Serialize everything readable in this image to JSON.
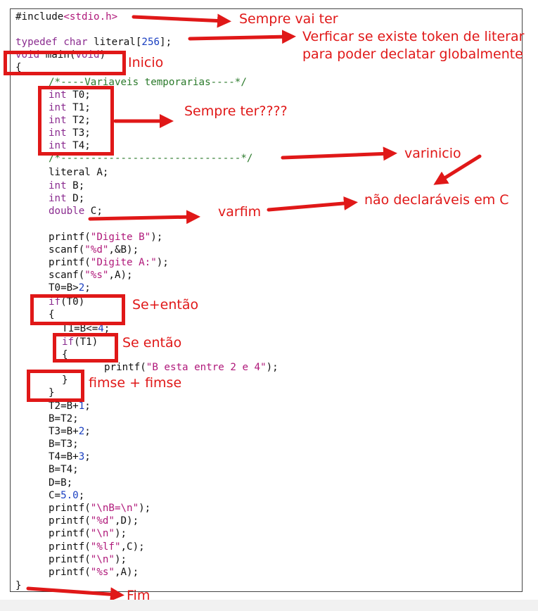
{
  "code": {
    "include_head": "#include",
    "include_header": "<stdio.h>",
    "typedef_kw": "typedef",
    "typedef_type": "char",
    "typedef_name": "literal",
    "typedef_open": "[",
    "typedef_size": "256",
    "typedef_close": "];",
    "main_void1": "void",
    "main_name": "main(",
    "main_void2": "void",
    "main_close": ")",
    "open_brace": "{",
    "comment_top": "/*----Variaveis temporarias----*/",
    "t_decls": [
      {
        "type": "int",
        "name": "T0;"
      },
      {
        "type": "int",
        "name": "T1;"
      },
      {
        "type": "int",
        "name": "T2;"
      },
      {
        "type": "int",
        "name": "T3;"
      },
      {
        "type": "int",
        "name": "T4;"
      }
    ],
    "comment_bottom": "/*------------------------------*/",
    "decl_a_type": "literal",
    "decl_a_name": "A;",
    "decl_b_type": "int",
    "decl_b_name": "B;",
    "decl_d_type": "int",
    "decl_d_name": "D;",
    "decl_c_type": "double",
    "decl_c_name": "C;",
    "printf1_head": "printf(",
    "printf1_str": "\"Digite B\"",
    "printf1_tail": ");",
    "scanf1_head": "scanf(",
    "scanf1_str": "\"%d\"",
    "scanf1_tail": ",&B);",
    "printf2_head": "printf(",
    "printf2_str": "\"Digite A:\"",
    "printf2_tail": ");",
    "scanf2_head": "scanf(",
    "scanf2_str": "\"%s\"",
    "scanf2_tail": ",A);",
    "t0_head": "T0=B>",
    "t0_num": "2",
    "t0_tail": ";",
    "if1_kw": "if",
    "if1_tail": "(T0)",
    "if1_brace": "{",
    "t1_head": "T1=B<=",
    "t1_num": "4",
    "t1_tail": ";",
    "if2_kw": "if",
    "if2_tail": "(T1)",
    "if2_brace": "{",
    "printf3_head": "printf(",
    "printf3_str": "\"B esta entre 2 e 4\"",
    "printf3_tail": ");",
    "close_inner": "}",
    "close_outer": "}",
    "t2_head": "T2=B+",
    "t2_num": "1",
    "t2_tail": ";",
    "b_t2": "B=T2;",
    "t3_head": "T3=B+",
    "t3_num": "2",
    "t3_tail": ";",
    "b_t3": "B=T3;",
    "t4_head": "T4=B+",
    "t4_num": "3",
    "t4_tail": ";",
    "b_t4": "B=T4;",
    "d_b": "D=B;",
    "c_head": "C=",
    "c_num": "5.0",
    "c_tail": ";",
    "printf4_head": "printf(",
    "printf4_str": "\"\\nB=\\n\"",
    "printf4_tail": ");",
    "printf5_head": "printf(",
    "printf5_str": "\"%d\"",
    "printf5_tail": ",D);",
    "printf6_head": "printf(",
    "printf6_str": "\"\\n\"",
    "printf6_tail": ");",
    "printf7_head": "printf(",
    "printf7_str": "\"%lf\"",
    "printf7_tail": ",C);",
    "printf8_head": "printf(",
    "printf8_str": "\"\\n\"",
    "printf8_tail": ");",
    "printf9_head": "printf(",
    "printf9_str": "\"%s\"",
    "printf9_tail": ",A);",
    "close_main": "}"
  },
  "annotations": {
    "sempre_vai_ter": "Sempre vai ter",
    "verificar_line1": "Verficar se existe token de literar",
    "verificar_line2": "para poder declatar globalmente",
    "inicio": "Inicio",
    "sempre_ter": "Sempre ter????",
    "varinicio": "varinicio",
    "nao_declaraveis": "não declaráveis em C",
    "varfim": "varfim",
    "se_entao_plus": "Se+então",
    "se_entao": "Se então",
    "fimse": "fimse + fimse",
    "fim": "Fim"
  },
  "colors": {
    "annotation": "#e01818",
    "keyword": "#8a2b8f",
    "string": "#b0197a",
    "number": "#1a3fc1",
    "comment": "#2b7a2b"
  }
}
